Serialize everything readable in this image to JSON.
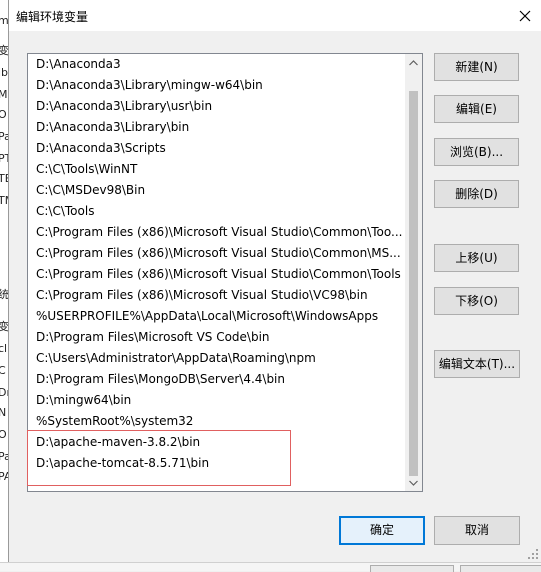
{
  "background_window": {
    "fragments": [
      "m",
      "变",
      "ib",
      "M",
      "O",
      "Pa",
      "PT",
      "TE",
      "TM",
      "统",
      "变",
      "cl",
      "C",
      "Dr",
      "N",
      "O",
      "Pa",
      "PA"
    ]
  },
  "dialog": {
    "title": "编辑环境变量",
    "close_icon": "close-icon"
  },
  "path_list": {
    "items": [
      "D:\\Anaconda3",
      "D:\\Anaconda3\\Library\\mingw-w64\\bin",
      "D:\\Anaconda3\\Library\\usr\\bin",
      "D:\\Anaconda3\\Library\\bin",
      "D:\\Anaconda3\\Scripts",
      "C:\\C\\Tools\\WinNT",
      "C:\\C\\MSDev98\\Bin",
      "C:\\C\\Tools",
      "C:\\Program Files (x86)\\Microsoft Visual Studio\\Common\\Too...",
      "C:\\Program Files (x86)\\Microsoft Visual Studio\\Common\\MS...",
      "C:\\Program Files (x86)\\Microsoft Visual Studio\\Common\\Tools",
      "C:\\Program Files (x86)\\Microsoft Visual Studio\\VC98\\bin",
      "%USERPROFILE%\\AppData\\Local\\Microsoft\\WindowsApps",
      "D:\\Program Files\\Microsoft VS Code\\bin",
      "C:\\Users\\Administrator\\AppData\\Roaming\\npm",
      "D:\\Program Files\\MongoDB\\Server\\4.4\\bin",
      "D:\\mingw64\\bin",
      "%SystemRoot%\\system32",
      "D:\\apache-maven-3.8.2\\bin",
      "D:\\apache-tomcat-8.5.71\\bin"
    ],
    "highlight_color": "#e06060"
  },
  "buttons": {
    "new": "新建(N)",
    "edit": "编辑(E)",
    "browse": "浏览(B)...",
    "delete": "删除(D)",
    "move_up": "上移(U)",
    "move_down": "下移(O)",
    "edit_text": "编辑文本(T)...",
    "ok": "确定",
    "cancel": "取消"
  },
  "colors": {
    "accent": "#0078d7",
    "dialog_bg": "#f0f0f0",
    "button_bg": "#e1e1e1"
  }
}
